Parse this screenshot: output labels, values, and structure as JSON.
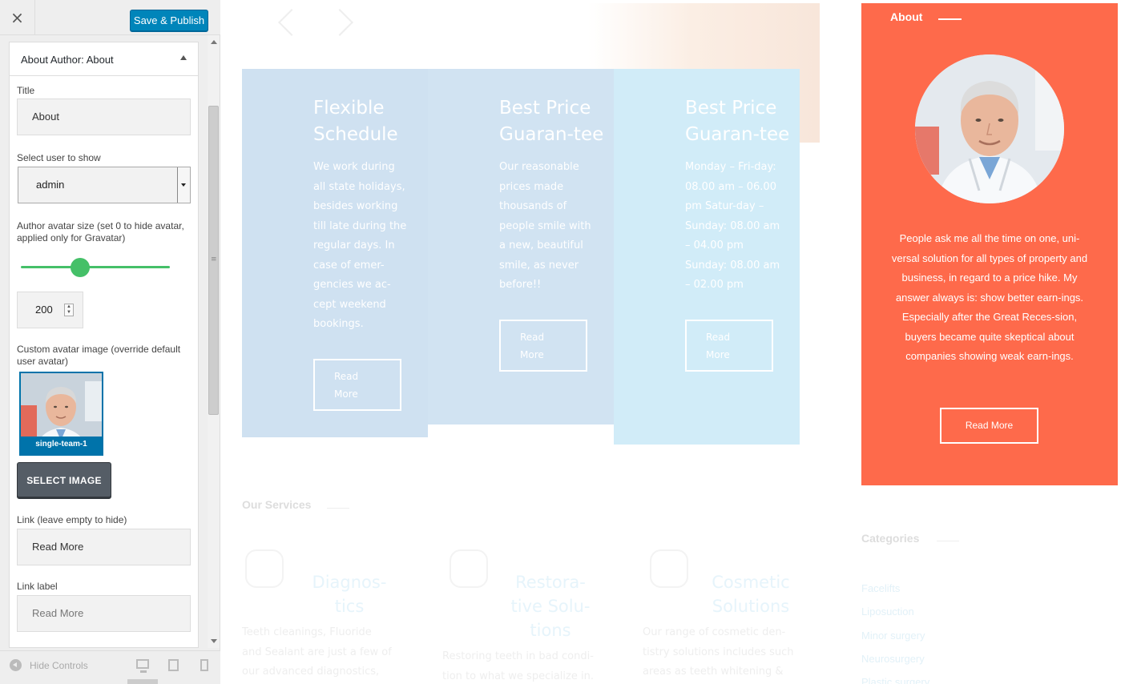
{
  "customizer": {
    "close_icon": "×",
    "publish_label": "Save & Publish",
    "section": {
      "prefix": "About Author:",
      "name": "About"
    },
    "fields": {
      "title_label": "Title",
      "title_value": "About",
      "user_label": "Select user to show",
      "user_value": "admin",
      "avatar_size_label": "Author avatar size (set 0 to hide avatar, applied only for Gravatar)",
      "avatar_size_slider_fraction": 0.4,
      "avatar_size_value": "200",
      "custom_avatar_label": "Custom avatar image (override default user avatar)",
      "avatar_filename": "single-team-1",
      "select_image_label": "SELECT IMAGE",
      "link_label": "Link (leave empty to hide)",
      "link_value": "Read More",
      "link_label_label": "Link label",
      "link_label_value": "Read More"
    },
    "footer": {
      "hide_controls": "Hide Controls"
    }
  },
  "preview": {
    "features": [
      {
        "title": "Flexible Schedule",
        "text": "We work during all state holidays, besides working till late during the regular days. In case of emer-gencies we ac-cept weekend bookings.",
        "button": "Read More",
        "color": "#cfe1f1"
      },
      {
        "title": "Best Price Guaran-tee",
        "text": "Our reasonable prices made thousands of people smile with a new, beautiful smile, as never before!!",
        "button": "Read More",
        "color": "#d1e3f2"
      },
      {
        "title": "Best Price Guaran-tee",
        "text": "Monday – Fri-day: 08.00 am – 06.00 pm Satur-day – Sunday: 08.00 am – 04.00 pm Sunday: 08.00 am – 02.00 pm",
        "button": "Read More",
        "color": "#d1ecf8"
      }
    ],
    "about": {
      "title": "About",
      "text": "People ask me all the time on one, uni-versal solution for all types of property and business, in regard to a price hike. My answer always is: show better earn-ings. Especially after the Great Reces-sion, buyers became quite skeptical about companies showing weak earn-ings.",
      "button": "Read More",
      "color": "#fe6a4b"
    },
    "services_heading": "Our Services",
    "services": [
      {
        "title": "Diagnos-tics",
        "text": "Teeth cleanings, Fluoride and Sealant are just a few of our advanced diagnostics, and pre",
        "icon": "tooth-diagnostic-icon"
      },
      {
        "title": "Restora-tive Solu-tions",
        "text": "Restoring teeth in bad condi-tion to what we specialize in. It",
        "icon": "toothbrush-icon"
      },
      {
        "title": "Cosmetic Solutions",
        "text": "Our range of cosmetic den-tistry solutions includes such areas as teeth whitening &",
        "icon": "tooth-icon"
      }
    ],
    "categories_heading": "Categories",
    "categories": [
      "Facelifts",
      "Liposuction",
      "Minor surgery",
      "Neurosurgery",
      "Plastic surgery"
    ]
  }
}
